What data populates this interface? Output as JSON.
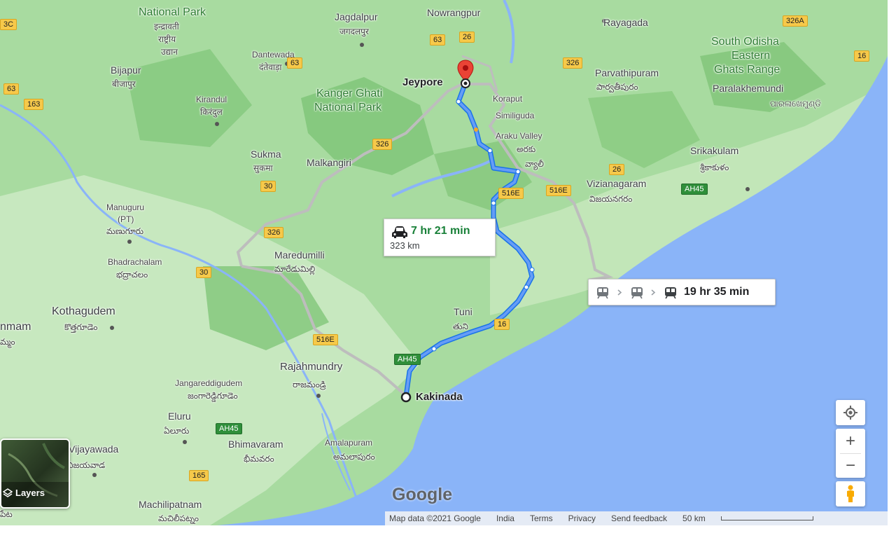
{
  "labels": {
    "national_park": "National Park",
    "indravati": "इन्द्रावती",
    "rashtriya": "राष्ट्रीय",
    "udyan": "उद्यान",
    "jagdalpur": "Jagdalpur",
    "jagdalpur_hi": "जगदलपुर",
    "nowrangpur": "Nowrangpur",
    "rayagada": "Rayagada",
    "south_odisha_1": "South Odisha",
    "south_odisha_2": "Eastern",
    "south_odisha_3": "Ghats Range",
    "dantewada": "Dantewada",
    "dantewada_hi": "दंतेवाड़ा",
    "bijapur": "Bijapur",
    "bijapur_hi": "बीजापुर",
    "jeypore": "Jeypore",
    "kanger_1": "Kanger Ghati",
    "kanger_2": "National Park",
    "koraput": "Koraput",
    "similiguda": "Similiguda",
    "parvathipuram": "Parvathipuram",
    "parvathipuram_te": "పార్వతీపురం",
    "paralakhemundi": "Paralakhemundi",
    "paralakhemundi_or": "ପାରଳାଖେମୁଣ୍ଡି",
    "kirandul": "Kirandul",
    "kirandul_hi": "किरंदुल",
    "araku_valley": "Araku Valley",
    "araku_te": "అరకు",
    "araku_te2": "వ్యాలీ",
    "sukma": "Sukma",
    "sukma_hi": "सुकमा",
    "malkangiri": "Malkangiri",
    "srikakulam": "Srikakulam",
    "srikakulam_te": "శ్రీకాకుళం",
    "vizianagaram": "Vizianagaram",
    "vizianagaram_te": "విజయనగరం",
    "manuguru_1": "Manuguru",
    "manuguru_2": "(PT)",
    "manuguru_te": "మణుగూరు",
    "bhadrachalam": "Bhadrachalam",
    "bhadrachalam_te": "భద్రాచలం",
    "maredumilli": "Maredumilli",
    "maredumilli_te": "మారేడుమిల్లి",
    "kothagudem": "Kothagudem",
    "kothagudem_te": "కొత్తగూడెం",
    "khammam": "nmam",
    "khammam_te": "మ్మం",
    "tuni": "Tuni",
    "tuni_te": "తుని",
    "rajahmundry": "Rajahmundry",
    "rajahmundry_te": "రాజమండ్రి",
    "jangareddigudem": "Jangareddigudem",
    "jangareddigudem_te": "జంగారెడ్డిగూడెం",
    "kakinada": "Kakinada",
    "eluru": "Eluru",
    "eluru_te": "ఏలూరు",
    "vijayawada": "Vijayawada",
    "vijayawada_te": "విజయవాడ",
    "bhimavaram": "Bhimavaram",
    "bhimavaram_te": "భీమవరం",
    "amalapuram": "Amalapuram",
    "amalapuram_te": "అమలాపురం",
    "machilipatnam": "Machilipatnam",
    "machilipatnam_te": "మచిలీపట్నం",
    "pata": "పేట"
  },
  "shields": {
    "s_3c": "3C",
    "s_63a": "63",
    "s_63b": "63",
    "s_26": "26",
    "s_326a": "326A",
    "s_16a": "16",
    "s_163": "163",
    "s_63c": "63",
    "s_326b": "326",
    "s_326c": "326",
    "s_26b": "26",
    "s_30a": "30",
    "s_516e_a": "516E",
    "s_516e_b": "516E",
    "s_326d": "326",
    "s_30b": "30",
    "s_16b": "16",
    "s_516e_c": "516E",
    "s_ah45_a": "AH45",
    "s_ah45_b": "AH45",
    "s_ah45_c": "AH45",
    "s_165": "165"
  },
  "route_drive": {
    "duration": "7 hr 21 min",
    "distance": "323 km"
  },
  "route_train": {
    "duration": "19 hr 35 min"
  },
  "controls": {
    "layers": "Layers",
    "zoom_in": "+",
    "zoom_out": "−"
  },
  "footer": {
    "map_data": "Map data ©2021 Google",
    "country": "India",
    "terms": "Terms",
    "privacy": "Privacy",
    "feedback": "Send feedback",
    "scale": "50 km"
  },
  "logo": {
    "text": "Google"
  },
  "colors": {
    "route_primary": "#4285f4",
    "route_alt": "#9aa0a6",
    "sea": "#8ab4f8",
    "land": "#9fd69a",
    "pin": "#ea4335"
  }
}
